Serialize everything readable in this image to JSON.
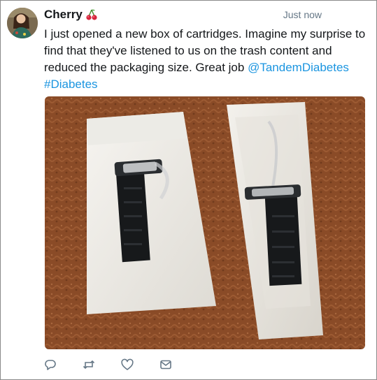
{
  "tweet": {
    "author_name": "Cherry",
    "author_emoji": "cherry-emoji",
    "timestamp": "Just now",
    "text_before": "I just opened a new box of cartridges. Imagine my surprise to find that they've listened to us on the trash content and reduced the packaging size. Great job ",
    "mention": "@TandemDiabetes",
    "hashtag": "#Diabetes",
    "link_color": "#1b95e0"
  },
  "actions": [
    {
      "icon": "reply-icon"
    },
    {
      "icon": "retweet-icon"
    },
    {
      "icon": "like-icon"
    },
    {
      "icon": "dm-icon"
    }
  ]
}
